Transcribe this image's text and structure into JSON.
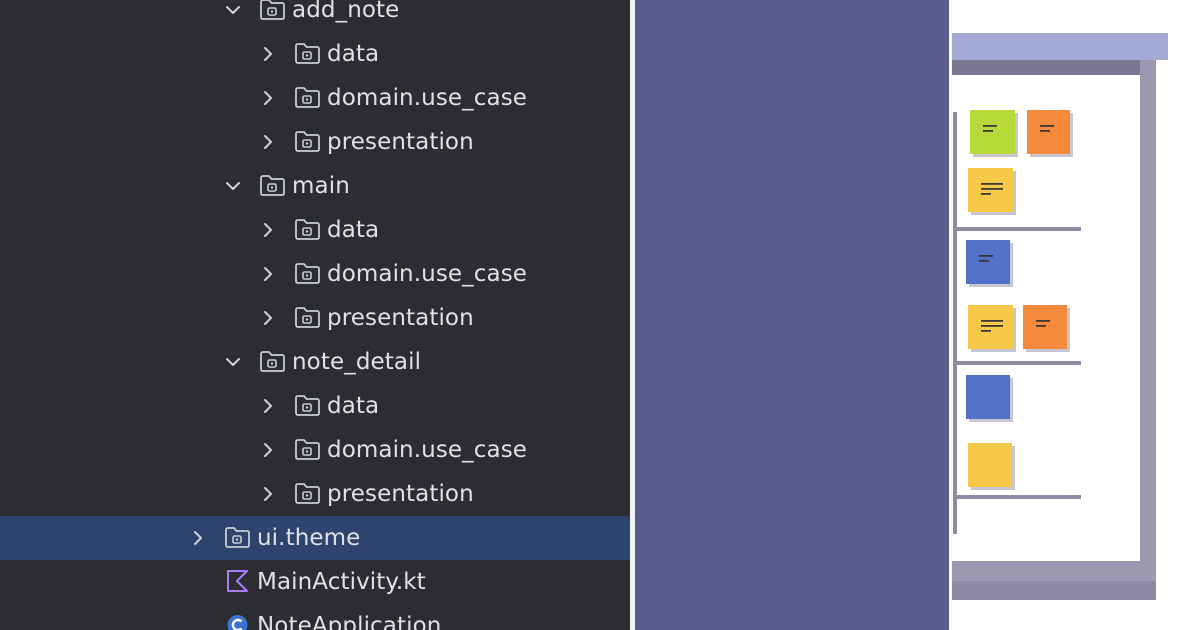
{
  "tree": {
    "rows": [
      {
        "label": "add_note",
        "kind": "folder",
        "expanded": true,
        "depth": 2
      },
      {
        "label": "data",
        "kind": "folder",
        "expanded": false,
        "depth": 3
      },
      {
        "label": "domain.use_case",
        "kind": "folder",
        "expanded": false,
        "depth": 3
      },
      {
        "label": "presentation",
        "kind": "folder",
        "expanded": false,
        "depth": 3
      },
      {
        "label": "main",
        "kind": "folder",
        "expanded": true,
        "depth": 2
      },
      {
        "label": "data",
        "kind": "folder",
        "expanded": false,
        "depth": 3
      },
      {
        "label": "domain.use_case",
        "kind": "folder",
        "expanded": false,
        "depth": 3
      },
      {
        "label": "presentation",
        "kind": "folder",
        "expanded": false,
        "depth": 3
      },
      {
        "label": "note_detail",
        "kind": "folder",
        "expanded": true,
        "depth": 2
      },
      {
        "label": "data",
        "kind": "folder",
        "expanded": false,
        "depth": 3
      },
      {
        "label": "domain.use_case",
        "kind": "folder",
        "expanded": false,
        "depth": 3
      },
      {
        "label": "presentation",
        "kind": "folder",
        "expanded": false,
        "depth": 3
      },
      {
        "label": "ui.theme",
        "kind": "folder",
        "expanded": false,
        "depth": 1,
        "selected": true
      },
      {
        "label": "MainActivity.kt",
        "kind": "kotlin-file",
        "depth": 1
      },
      {
        "label": "NoteApplication",
        "kind": "kotlin-class",
        "depth": 1
      }
    ]
  },
  "colors": {
    "tree_bg": "#2b2d30",
    "selection": "#2e436e",
    "text": "#dfe1e5",
    "purple_panel": "#5a5e8f",
    "note_green": "#b8d93a",
    "note_orange": "#f58a3c",
    "note_yellow": "#f7c948",
    "note_blue": "#5172c7"
  },
  "illustration": {
    "name": "kanban-board",
    "notes": [
      {
        "color": "green"
      },
      {
        "color": "orange"
      },
      {
        "color": "yellow"
      },
      {
        "color": "blue"
      },
      {
        "color": "yellow"
      },
      {
        "color": "orange"
      },
      {
        "color": "blue"
      },
      {
        "color": "yellow"
      }
    ]
  }
}
